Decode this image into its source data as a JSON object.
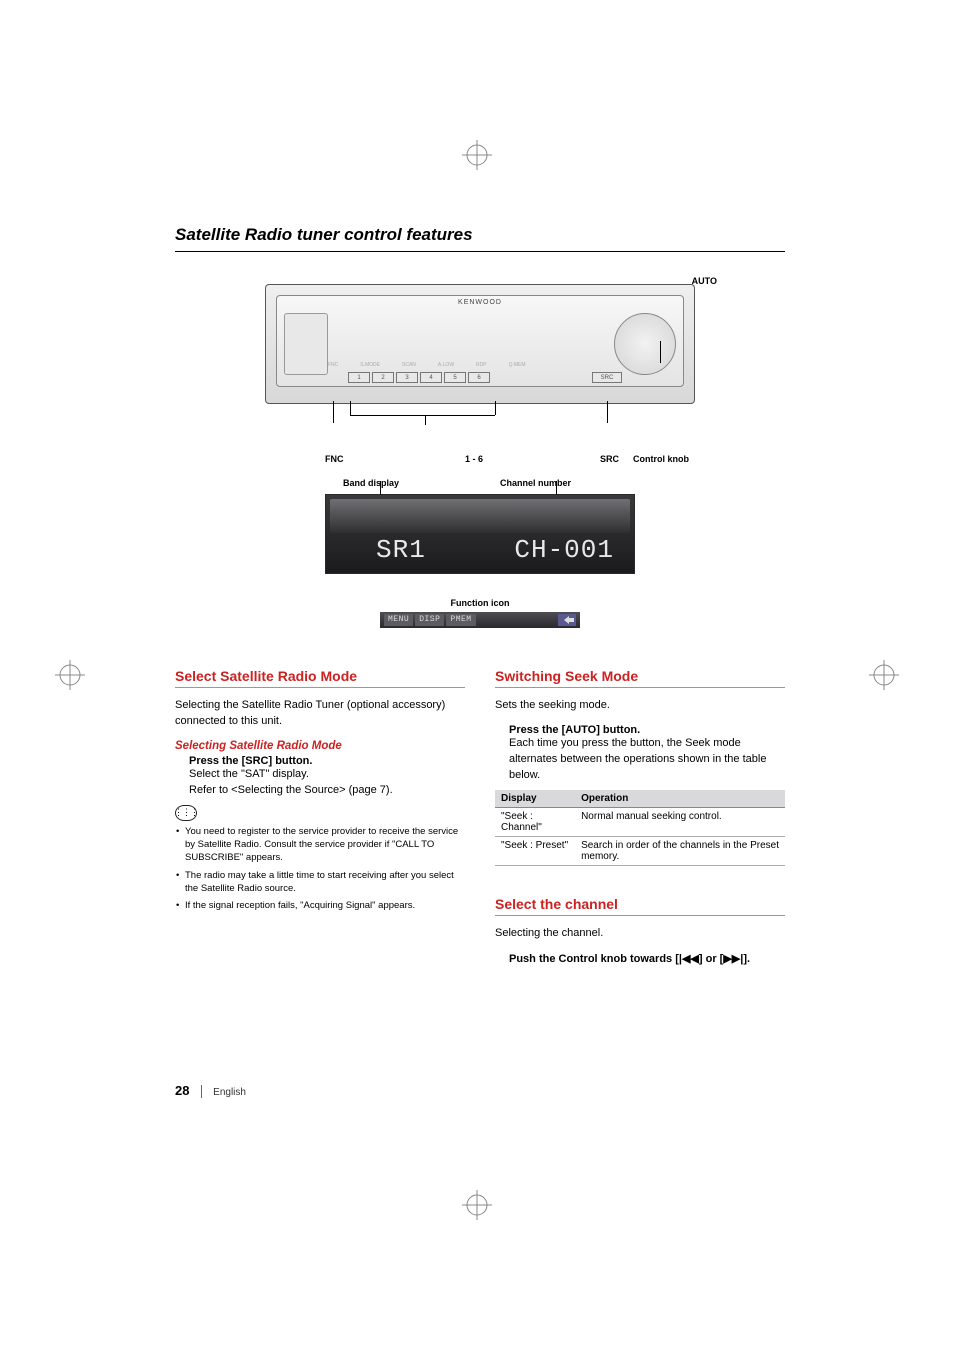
{
  "page_title": "Satellite Radio tuner control features",
  "diagram": {
    "brand": "KENWOOD",
    "auto_label": "AUTO",
    "bottom_labels": {
      "fnc": "FNC",
      "one_six": "1 - 6",
      "src": "SRC",
      "control_knob": "Control knob"
    },
    "display_labels": {
      "band": "Band display",
      "channel": "Channel number"
    },
    "display_values": {
      "band_text": "SR1",
      "channel_text": "CH-001"
    },
    "func_icon_label": "Function icon",
    "func_icons": [
      "MENU",
      "DISP",
      "PMEM"
    ],
    "face_buttons": [
      "1",
      "2",
      "3",
      "4",
      "5",
      "6"
    ],
    "face_small_buttons": [
      "FNC",
      "S.MODE",
      "SCAN",
      "A.LOW",
      "RDP",
      "Q.MEM"
    ],
    "src_face": "SRC"
  },
  "left": {
    "section1_heading": "Select Satellite Radio Mode",
    "section1_intro": "Selecting the Satellite Radio Tuner (optional accessory) connected to this unit.",
    "section1_sub": "Selecting Satellite Radio Mode",
    "section1_step_bold": "Press the [SRC] button.",
    "section1_step_text1": "Select the \"SAT\" display.",
    "section1_step_text2": "Refer to <Selecting the Source> (page 7).",
    "notes": [
      "You need to register to the service provider to receive the service by Satellite Radio. Consult the service provider if \"CALL TO SUBSCRIBE\" appears.",
      "The radio may take a little time to start receiving after you select the Satellite Radio source.",
      "If the signal reception fails, \"Acquiring Signal\" appears."
    ]
  },
  "right": {
    "section1_heading": "Switching Seek Mode",
    "section1_intro": "Sets the seeking mode.",
    "section1_step_bold": "Press the [AUTO] button.",
    "section1_text": "Each time you press the button, the Seek mode alternates between the operations shown in the table below.",
    "table_headers": {
      "c1": "Display",
      "c2": "Operation"
    },
    "table_rows": [
      {
        "display": "\"Seek : Channel\"",
        "operation": "Normal manual seeking control."
      },
      {
        "display": "\"Seek : Preset\"",
        "operation": "Search in order of the channels in the Preset memory."
      }
    ],
    "section2_heading": "Select the channel",
    "section2_intro": "Selecting the channel.",
    "section2_step_bold_pre": "Push the Control knob towards [",
    "section2_step_bold_mid": "] or [",
    "section2_step_bold_post": "]."
  },
  "footer": {
    "page_number": "28",
    "language": "English"
  }
}
